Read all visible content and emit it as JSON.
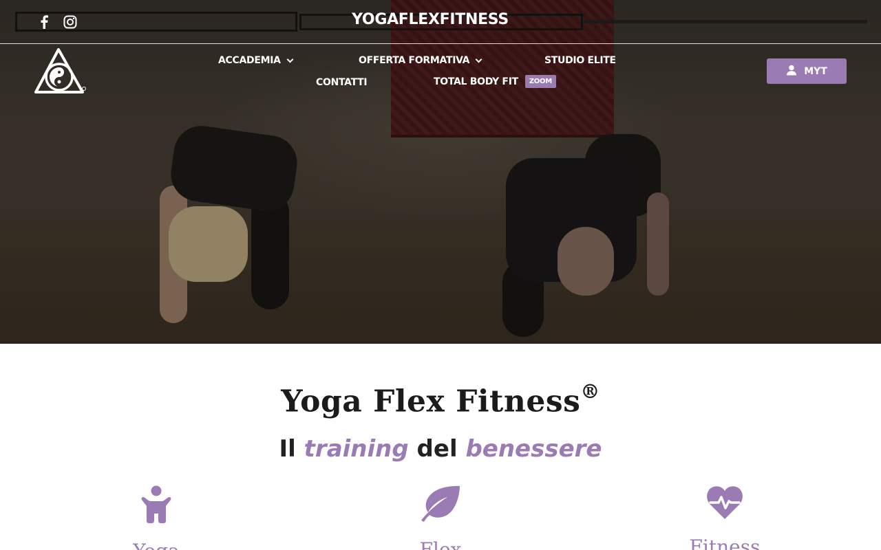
{
  "brand": {
    "name": "YOGAFLEXFITNESS"
  },
  "social": [
    {
      "icon": "facebook-icon"
    },
    {
      "icon": "instagram-icon"
    }
  ],
  "nav": {
    "items": [
      {
        "label": "ACCADEMIA",
        "has_dropdown": true
      },
      {
        "label": "OFFERTA FORMATIVA",
        "has_dropdown": true
      },
      {
        "label": "STUDIO ELITE",
        "has_dropdown": false
      },
      {
        "label": "CONTATTI",
        "has_dropdown": false
      },
      {
        "label": "TOTAL BODY FIT",
        "badge": "ZOOM"
      }
    ],
    "cta": {
      "label": "MYT",
      "icon": "user-icon"
    }
  },
  "main": {
    "title": "Yoga Flex Fitness",
    "title_mark": "®",
    "subtitle": {
      "p1": "Il ",
      "p2": "training",
      "p3": " del ",
      "p4": "benessere"
    },
    "features": [
      {
        "icon": "child-figure-icon",
        "label": "Yoga"
      },
      {
        "icon": "leaf-icon",
        "label": "Flex"
      },
      {
        "icon": "heartbeat-icon",
        "label": "Fitness"
      }
    ]
  },
  "colors": {
    "accent": "#9b7bb4",
    "text": "#1b1b1b"
  }
}
